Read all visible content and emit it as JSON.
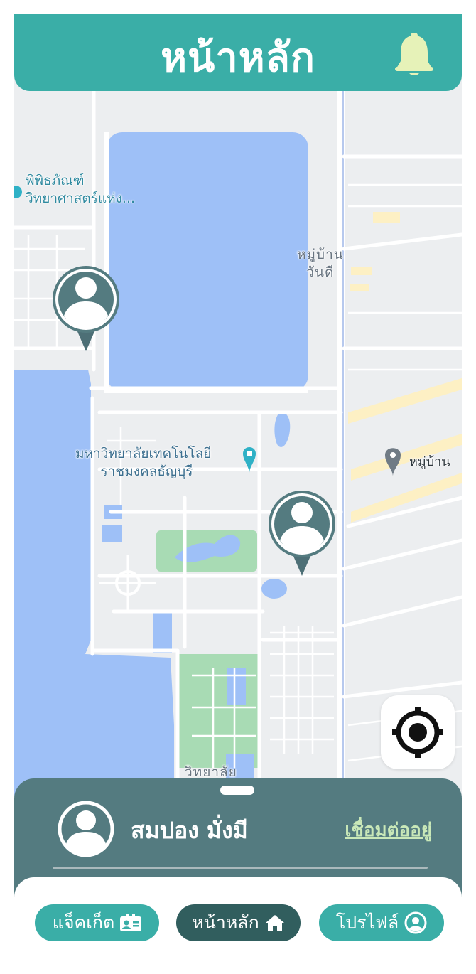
{
  "header": {
    "title": "หน้าหลัก"
  },
  "map": {
    "labels": {
      "museum_line1": "พิพิธภัณฑ์",
      "museum_line2": "วิทยาศาสตร์แห่ง...",
      "village1_line1": "หมู่บ้าน",
      "village1_line2": "วันดี",
      "university_line1": "มหาวิทยาลัยเทคโนโลยี",
      "university_line2": "ราชมงคลธัญบุรี",
      "village2": "หมู่บ้าน",
      "bottom": "วิทยาลัย"
    }
  },
  "user": {
    "name": "สมปอง มั่งมี",
    "status": "เชื่อมต่ออยู่"
  },
  "nav": {
    "jacket": "แจ็คเก็ต",
    "home": "หน้าหลัก",
    "profile": "โปรไฟล์"
  },
  "colors": {
    "primary": "#3aaea7",
    "active_nav": "#315e5e",
    "sheet": "#547b80",
    "status": "#c9e8b8",
    "water": "#9ec0f7",
    "park": "#a8dbb4",
    "pin": "#547b80"
  },
  "icons": {
    "bell": "bell-icon",
    "locate": "crosshair-icon",
    "avatar": "user-avatar-icon",
    "jacket": "id-card-icon",
    "home": "house-icon",
    "profile": "user-circle-icon"
  }
}
